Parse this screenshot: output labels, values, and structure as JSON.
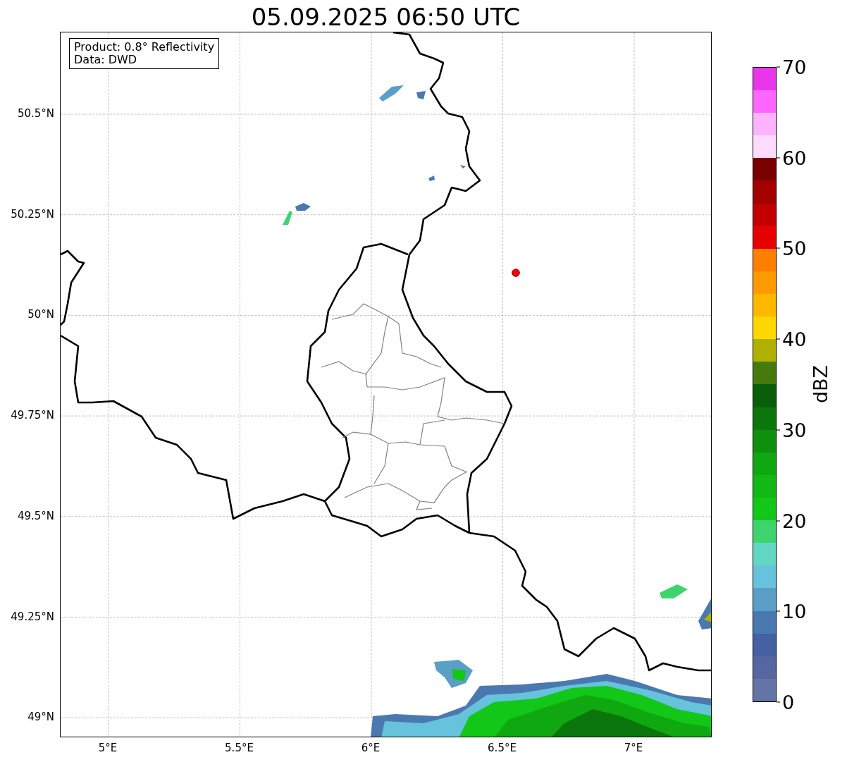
{
  "title": "05.09.2025 06:50 UTC",
  "legend": [
    "Product: 0.8° Reflectivity",
    "Data: DWD"
  ],
  "axes": {
    "xticks": [
      "5°E",
      "5.5°E",
      "6°E",
      "6.5°E",
      "7°E"
    ],
    "yticks": [
      "50.5°N",
      "50.25°N",
      "50°N",
      "49.75°N",
      "49.5°N",
      "49.25°N",
      "49°N"
    ]
  },
  "colorbar": {
    "label": "dBZ",
    "ticks": [
      "70",
      "60",
      "50",
      "40",
      "30",
      "20",
      "10",
      "0"
    ],
    "bands": [
      {
        "color": "#6474a6"
      },
      {
        "color": "#5566a0"
      },
      {
        "color": "#4560a3"
      },
      {
        "color": "#4a79b0"
      },
      {
        "color": "#5b9ec6"
      },
      {
        "color": "#67c2dc"
      },
      {
        "color": "#62d8c4"
      },
      {
        "color": "#3dd46e"
      },
      {
        "color": "#12c718"
      },
      {
        "color": "#12b914"
      },
      {
        "color": "#10a810"
      },
      {
        "color": "#0e8f0e"
      },
      {
        "color": "#0b760b"
      },
      {
        "color": "#0a5e0a"
      },
      {
        "color": "#457a0c"
      },
      {
        "color": "#afb000"
      },
      {
        "color": "#ffd700"
      },
      {
        "color": "#ffb800"
      },
      {
        "color": "#ff9b00"
      },
      {
        "color": "#ff7f00"
      },
      {
        "color": "#e60000"
      },
      {
        "color": "#c20000"
      },
      {
        "color": "#a30000"
      },
      {
        "color": "#7a0000"
      },
      {
        "color": "#ffdcff"
      },
      {
        "color": "#ffb3ff"
      },
      {
        "color": "#ff66ff"
      },
      {
        "color": "#e936ea"
      }
    ]
  }
}
